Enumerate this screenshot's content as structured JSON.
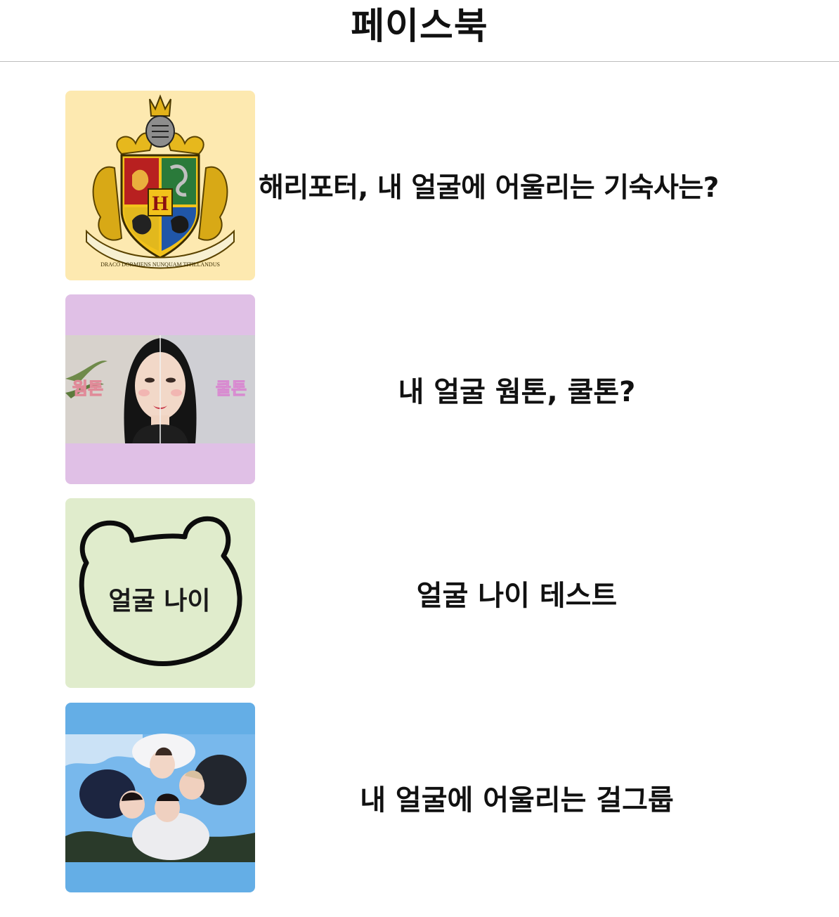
{
  "header": {
    "title": "페이스북"
  },
  "cards": [
    {
      "title": "해리포터, 내 얼굴에 어울리는 기숙사는?",
      "thumb_bg": "#fde9b0",
      "thumb_icon": "hogwarts-crest",
      "crest_text": "DRACO DORMIENS NUNQUAM TITILLANDUS",
      "crest_letter": "H"
    },
    {
      "title": "내 얼굴 웜톤, 쿨톤?",
      "thumb_bg": "#e0c0e6",
      "thumb_icon": "face-photo",
      "left_label": "웜톤",
      "right_label": "쿨톤"
    },
    {
      "title": "얼굴 나이 테스트",
      "thumb_bg": "#e0eccc",
      "thumb_icon": "bear-outline",
      "inner_label": "얼굴 나이"
    },
    {
      "title": "내 얼굴에 어울리는 걸그룹",
      "thumb_bg": "#64aee6",
      "thumb_icon": "group-photo"
    }
  ]
}
